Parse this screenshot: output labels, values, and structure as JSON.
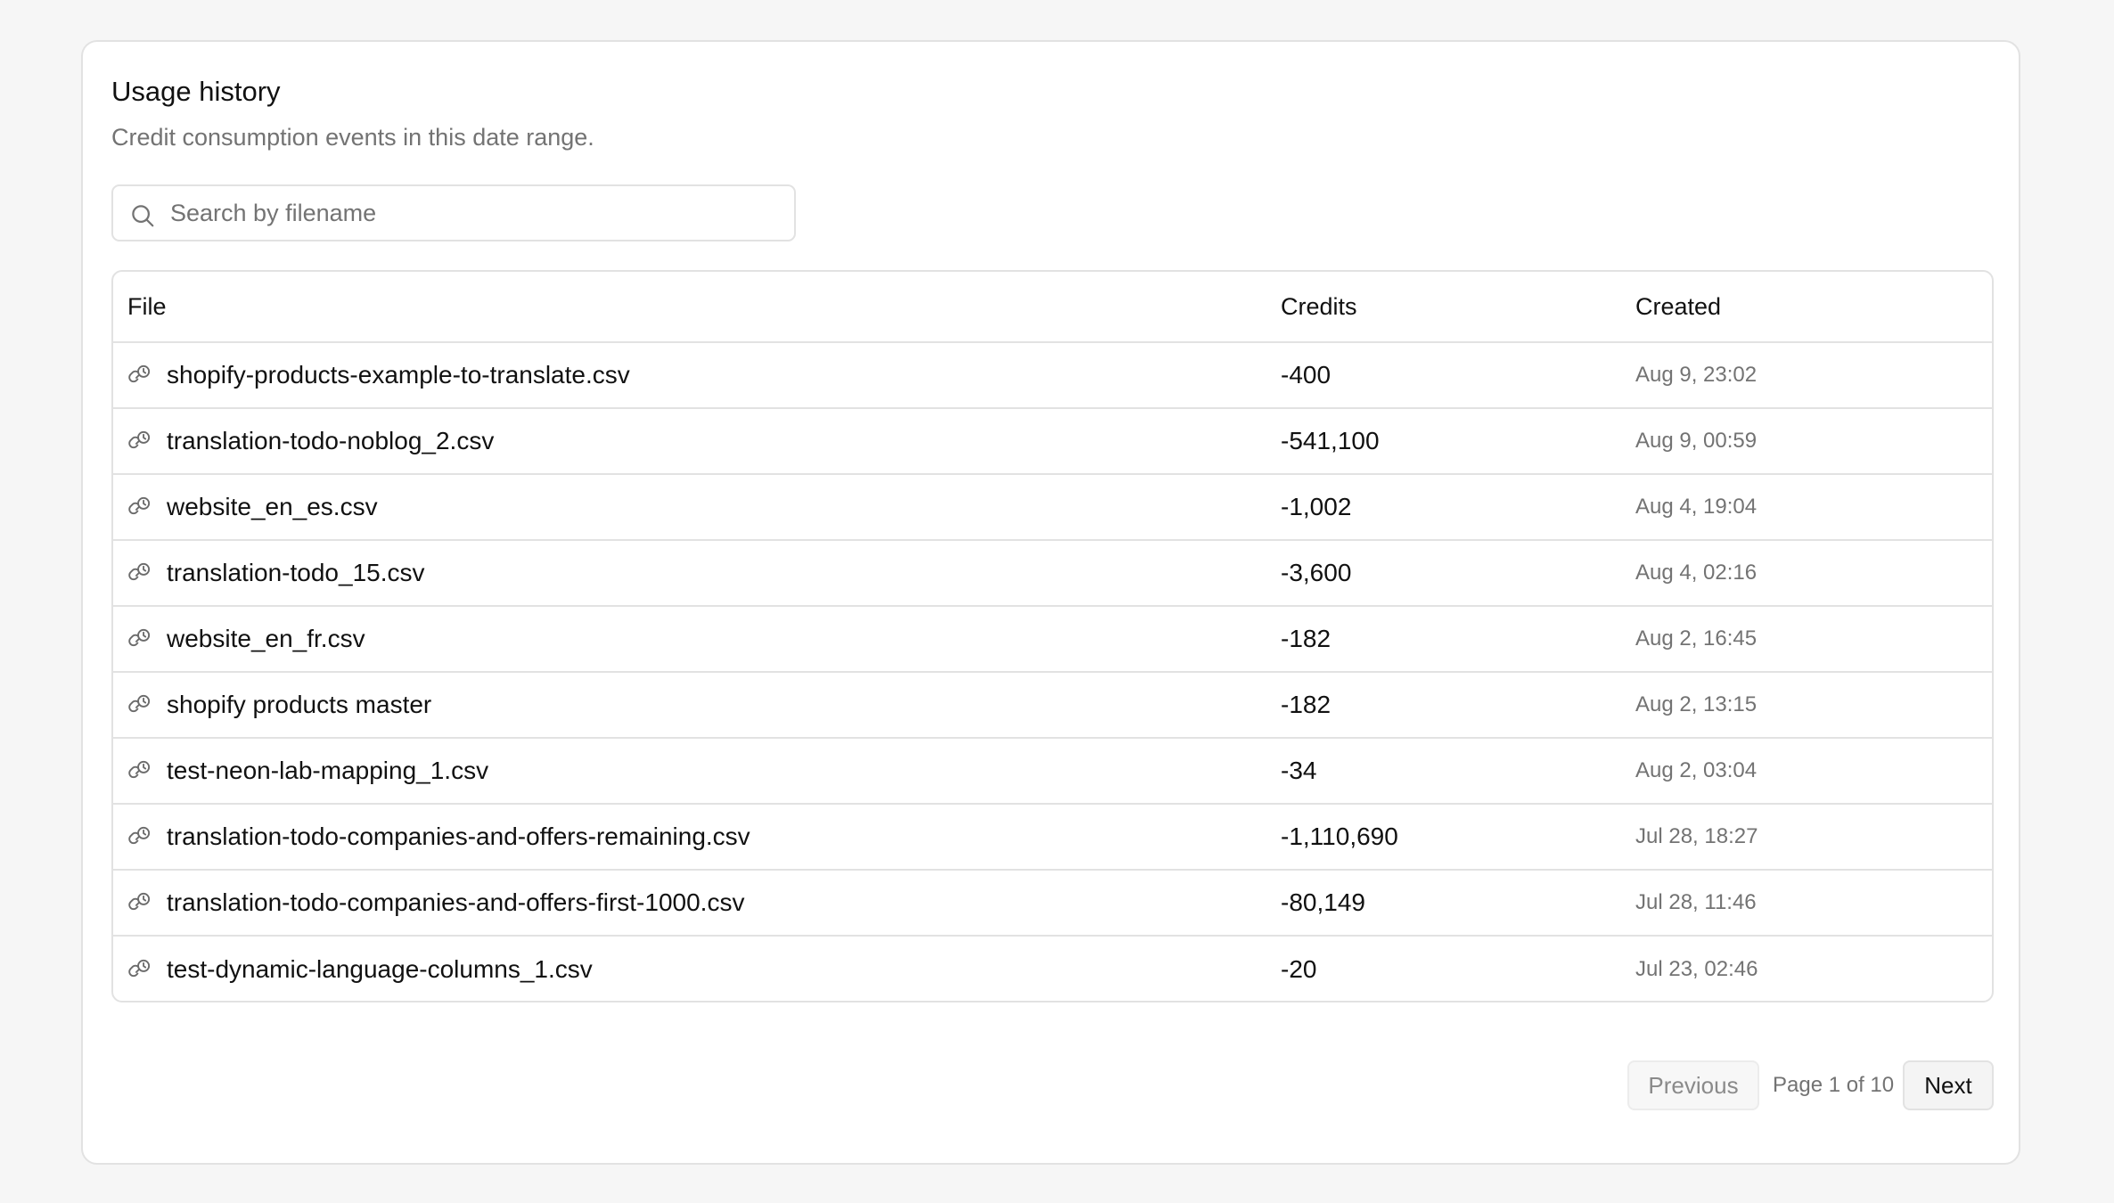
{
  "usage": {
    "title": "Usage history",
    "subtitle": "Credit consumption events in this date range."
  },
  "search": {
    "icon": "search-icon",
    "placeholder": "Search by filename",
    "value": ""
  },
  "table": {
    "headers": {
      "file": "File",
      "credits": "Credits",
      "created": "Created"
    },
    "row_icon": "link-icon",
    "rows": [
      {
        "file": "shopify-products-example-to-translate.csv",
        "credits": "-400",
        "created": "Aug 9, 23:02"
      },
      {
        "file": "translation-todo-noblog_2.csv",
        "credits": "-541,100",
        "created": "Aug 9, 00:59"
      },
      {
        "file": "website_en_es.csv",
        "credits": "-1,002",
        "created": "Aug 4, 19:04"
      },
      {
        "file": "translation-todo_15.csv",
        "credits": "-3,600",
        "created": "Aug 4, 02:16"
      },
      {
        "file": "website_en_fr.csv",
        "credits": "-182",
        "created": "Aug 2, 16:45"
      },
      {
        "file": "shopify products master",
        "credits": "-182",
        "created": "Aug 2, 13:15"
      },
      {
        "file": "test-neon-lab-mapping_1.csv",
        "credits": "-34",
        "created": "Aug 2, 03:04"
      },
      {
        "file": "translation-todo-companies-and-offers-remaining.csv",
        "credits": "-1,110,690",
        "created": "Jul 28, 18:27"
      },
      {
        "file": "translation-todo-companies-and-offers-first-1000.csv",
        "credits": "-80,149",
        "created": "Jul 28, 11:46"
      },
      {
        "file": "test-dynamic-language-columns_1.csv",
        "credits": "-20",
        "created": "Jul 23, 02:46"
      }
    ]
  },
  "pagination": {
    "previous_label": "Previous",
    "page_info": "Page 1 of 10",
    "next_label": "Next",
    "current_page": 1,
    "total_pages": 10
  }
}
